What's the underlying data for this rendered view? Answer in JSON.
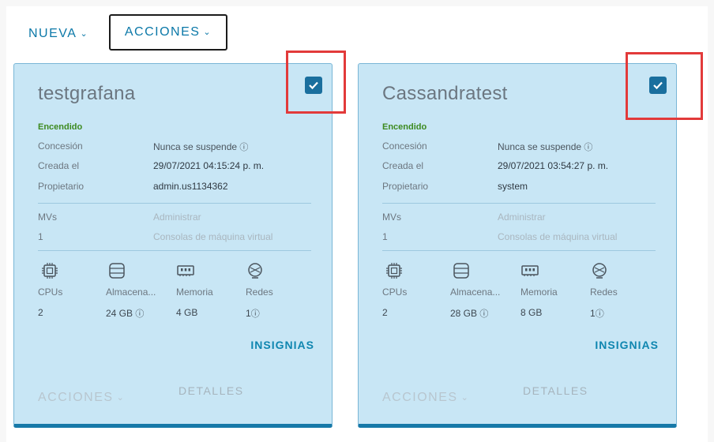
{
  "toolbar": {
    "nueva_label": "NUEVA",
    "acciones_label": "ACCIONES"
  },
  "cards": [
    {
      "name": "testgrafana",
      "checked": true,
      "status": "Encendido",
      "concesion_label": "Concesión",
      "concesion_value": "Nunca se suspende",
      "creada_label": "Creada el",
      "creada_value": "29/07/2021 04:15:24 p. m.",
      "propietario_label": "Propietario",
      "propietario_value": "admin.us1134362",
      "mvs_label": "MVs",
      "mvs_value": "1",
      "administrar_label": "Administrar",
      "consolas_label": "Consolas de máquina virtual",
      "cpus_label": "CPUs",
      "cpus_value": "2",
      "almacenamiento_label": "Almacena...",
      "almacenamiento_value": "24 GB",
      "memoria_label": "Memoria",
      "memoria_value": "4 GB",
      "redes_label": "Redes",
      "redes_value": "1",
      "insignias_label": "INSIGNIAS",
      "acciones_label": "ACCIONES",
      "detalles_label": "DETALLES"
    },
    {
      "name": "Cassandratest",
      "checked": true,
      "status": "Encendido",
      "concesion_label": "Concesión",
      "concesion_value": "Nunca se suspende",
      "creada_label": "Creada el",
      "creada_value": "29/07/2021 03:54:27 p. m.",
      "propietario_label": "Propietario",
      "propietario_value": "system",
      "mvs_label": "MVs",
      "mvs_value": "1",
      "administrar_label": "Administrar",
      "consolas_label": "Consolas de máquina virtual",
      "cpus_label": "CPUs",
      "cpus_value": "2",
      "almacenamiento_label": "Almacena...",
      "almacenamiento_value": "28 GB",
      "memoria_label": "Memoria",
      "memoria_value": "8 GB",
      "redes_label": "Redes",
      "redes_value": "1",
      "insignias_label": "INSIGNIAS",
      "acciones_label": "ACCIONES",
      "detalles_label": "DETALLES"
    }
  ],
  "colors": {
    "accent": "#0b78a8",
    "card_bg": "#c8e6f5",
    "status_on": "#3d8a1f",
    "highlight": "#e23a3a"
  }
}
